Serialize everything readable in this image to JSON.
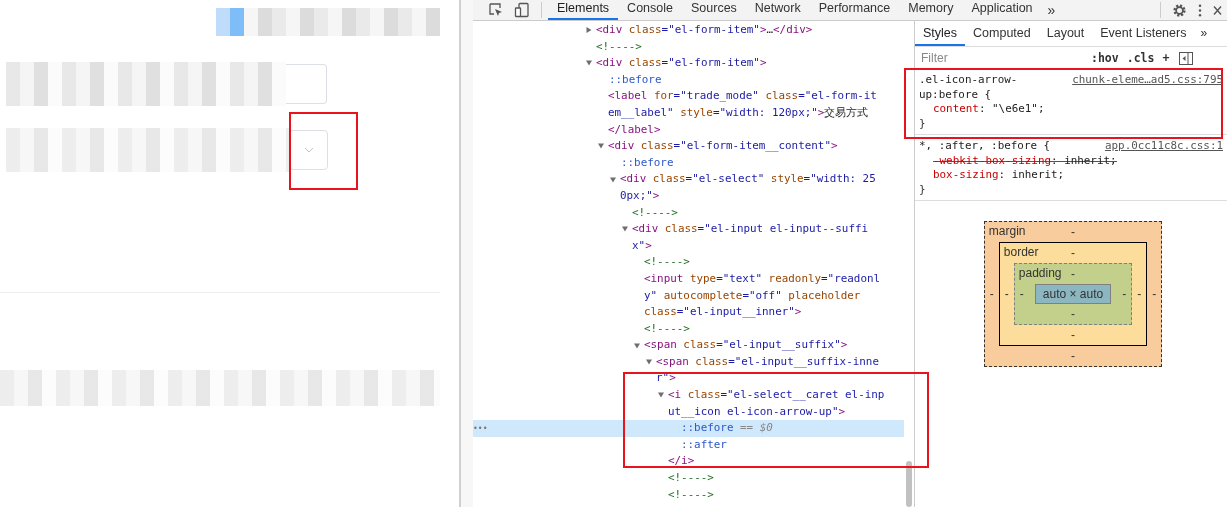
{
  "devtools_tabs": [
    {
      "label": "Elements",
      "selected": true
    },
    {
      "label": "Console",
      "selected": false
    },
    {
      "label": "Sources",
      "selected": false
    },
    {
      "label": "Network",
      "selected": false
    },
    {
      "label": "Performance",
      "selected": false
    },
    {
      "label": "Memory",
      "selected": false
    },
    {
      "label": "Application",
      "selected": false
    }
  ],
  "devtools_tabs_more": "»",
  "elements_panel": {
    "selection_marker": "•••",
    "tree": [
      {
        "kind": "element",
        "expanded": false,
        "selected": false,
        "lines": [
          [
            {
              "kind": "tag",
              "text": "<div"
            },
            {
              "kind": "attr",
              "text": " class"
            },
            {
              "kind": "val",
              "text": "=\"el-form-item\""
            },
            {
              "kind": "tag",
              "text": ">"
            },
            {
              "kind": "text",
              "text": "…"
            },
            {
              "kind": "tag",
              "text": "</div>"
            }
          ]
        ]
      },
      {
        "kind": "comment",
        "selected": false,
        "lines": [
          [
            {
              "kind": "comment",
              "text": "<!---->"
            }
          ]
        ]
      },
      {
        "kind": "element",
        "expanded": true,
        "selected": false,
        "lines": [
          [
            {
              "kind": "tag",
              "text": "<div"
            },
            {
              "kind": "attr",
              "text": " class"
            },
            {
              "kind": "val",
              "text": "=\"el-form-item\""
            },
            {
              "kind": "tag",
              "text": ">"
            }
          ]
        ],
        "children": [
          {
            "kind": "pseudo",
            "selected": false,
            "lines": [
              [
                {
                  "kind": "pseudo",
                  "text": "::before"
                }
              ]
            ]
          },
          {
            "kind": "inline",
            "selected": false,
            "lines": [
              [
                {
                  "kind": "tag",
                  "text": "<label"
                },
                {
                  "kind": "attr",
                  "text": " for"
                },
                {
                  "kind": "val",
                  "text": "=\"trade_mode\""
                },
                {
                  "kind": "attr",
                  "text": " class"
                },
                {
                  "kind": "val",
                  "text": "=\"el-form-it"
                }
              ],
              [
                {
                  "kind": "val",
                  "text": "em__label\""
                },
                {
                  "kind": "attr",
                  "text": " style"
                },
                {
                  "kind": "val",
                  "text": "=\"width: 120px;\""
                },
                {
                  "kind": "tag",
                  "text": ">"
                },
                {
                  "kind": "text",
                  "text": "交易方式"
                }
              ],
              [
                {
                  "kind": "tag",
                  "text": "</label>"
                }
              ]
            ]
          },
          {
            "kind": "element",
            "expanded": true,
            "selected": false,
            "lines": [
              [
                {
                  "kind": "tag",
                  "text": "<div"
                },
                {
                  "kind": "attr",
                  "text": " class"
                },
                {
                  "kind": "val",
                  "text": "=\"el-form-item__content\""
                },
                {
                  "kind": "tag",
                  "text": ">"
                }
              ]
            ],
            "children": [
              {
                "kind": "pseudo",
                "selected": false,
                "lines": [
                  [
                    {
                      "kind": "pseudo",
                      "text": "::before"
                    }
                  ]
                ]
              },
              {
                "kind": "element",
                "expanded": true,
                "selected": false,
                "lines": [
                  [
                    {
                      "kind": "tag",
                      "text": "<div"
                    },
                    {
                      "kind": "attr",
                      "text": " class"
                    },
                    {
                      "kind": "val",
                      "text": "=\"el-select\""
                    },
                    {
                      "kind": "attr",
                      "text": " style"
                    },
                    {
                      "kind": "val",
                      "text": "=\"width: 25"
                    }
                  ],
                  [
                    {
                      "kind": "val",
                      "text": "0px;\""
                    },
                    {
                      "kind": "tag",
                      "text": ">"
                    }
                  ]
                ],
                "children": [
                  {
                    "kind": "comment",
                    "selected": false,
                    "lines": [
                      [
                        {
                          "kind": "comment",
                          "text": "<!---->"
                        }
                      ]
                    ]
                  },
                  {
                    "kind": "element",
                    "expanded": true,
                    "selected": false,
                    "lines": [
                      [
                        {
                          "kind": "tag",
                          "text": "<div"
                        },
                        {
                          "kind": "attr",
                          "text": " class"
                        },
                        {
                          "kind": "val",
                          "text": "=\"el-input el-input--suffi"
                        }
                      ],
                      [
                        {
                          "kind": "val",
                          "text": "x\""
                        },
                        {
                          "kind": "tag",
                          "text": ">"
                        }
                      ]
                    ],
                    "children": [
                      {
                        "kind": "comment",
                        "selected": false,
                        "lines": [
                          [
                            {
                              "kind": "comment",
                              "text": "<!---->"
                            }
                          ]
                        ]
                      },
                      {
                        "kind": "inline",
                        "selected": false,
                        "lines": [
                          [
                            {
                              "kind": "tag",
                              "text": "<input"
                            },
                            {
                              "kind": "attr",
                              "text": " type"
                            },
                            {
                              "kind": "val",
                              "text": "=\"text\""
                            },
                            {
                              "kind": "attr",
                              "text": " readonly"
                            },
                            {
                              "kind": "val",
                              "text": "=\"readonl"
                            }
                          ],
                          [
                            {
                              "kind": "val",
                              "text": "y\""
                            },
                            {
                              "kind": "attr",
                              "text": " autocomplete"
                            },
                            {
                              "kind": "val",
                              "text": "=\"off\""
                            },
                            {
                              "kind": "attr",
                              "text": " placeholder"
                            }
                          ],
                          [
                            {
                              "kind": "attr",
                              "text": "class"
                            },
                            {
                              "kind": "val",
                              "text": "=\"el-input__inner\""
                            },
                            {
                              "kind": "tag",
                              "text": ">"
                            }
                          ]
                        ]
                      },
                      {
                        "kind": "comment",
                        "selected": false,
                        "lines": [
                          [
                            {
                              "kind": "comment",
                              "text": "<!---->"
                            }
                          ]
                        ]
                      },
                      {
                        "kind": "element",
                        "expanded": true,
                        "selected": false,
                        "lines": [
                          [
                            {
                              "kind": "tag",
                              "text": "<span"
                            },
                            {
                              "kind": "attr",
                              "text": " class"
                            },
                            {
                              "kind": "val",
                              "text": "=\"el-input__suffix\""
                            },
                            {
                              "kind": "tag",
                              "text": ">"
                            }
                          ]
                        ],
                        "children": [
                          {
                            "kind": "element",
                            "expanded": true,
                            "selected": false,
                            "lines": [
                              [
                                {
                                  "kind": "tag",
                                  "text": "<span"
                                },
                                {
                                  "kind": "attr",
                                  "text": " class"
                                },
                                {
                                  "kind": "val",
                                  "text": "=\"el-input__suffix-inne"
                                }
                              ],
                              [
                                {
                                  "kind": "val",
                                  "text": "r\""
                                },
                                {
                                  "kind": "tag",
                                  "text": ">"
                                }
                              ]
                            ],
                            "children": [
                              {
                                "kind": "element",
                                "expanded": true,
                                "selected": false,
                                "lines": [
                                  [
                                    {
                                      "kind": "tag",
                                      "text": "<i"
                                    },
                                    {
                                      "kind": "attr",
                                      "text": " class"
                                    },
                                    {
                                      "kind": "val",
                                      "text": "=\"el-select__caret el-inp"
                                    }
                                  ],
                                  [
                                    {
                                      "kind": "val",
                                      "text": "ut__icon el-icon-arrow-up\""
                                    },
                                    {
                                      "kind": "tag",
                                      "text": ">"
                                    }
                                  ]
                                ],
                                "closing": [
                                  {
                                    "kind": "tag",
                                    "text": "</i>"
                                  }
                                ],
                                "children": [
                                  {
                                    "kind": "pseudo",
                                    "selected": true,
                                    "lines": [
                                      [
                                        {
                                          "kind": "pseudo",
                                          "text": "::before"
                                        },
                                        {
                                          "kind": "note",
                                          "text": " == $0"
                                        }
                                      ]
                                    ]
                                  },
                                  {
                                    "kind": "pseudo",
                                    "selected": false,
                                    "lines": [
                                      [
                                        {
                                          "kind": "pseudo",
                                          "text": "::after"
                                        }
                                      ]
                                    ]
                                  }
                                ]
                              },
                              {
                                "kind": "comment",
                                "selected": false,
                                "lines": [
                                  [
                                    {
                                      "kind": "comment",
                                      "text": "<!---->"
                                    }
                                  ]
                                ]
                              },
                              {
                                "kind": "comment",
                                "selected": false,
                                "lines": [
                                  [
                                    {
                                      "kind": "comment",
                                      "text": "<!---->"
                                    }
                                  ]
                                ]
                              }
                            ]
                          }
                        ]
                      }
                    ]
                  }
                ]
              }
            ]
          }
        ]
      }
    ]
  },
  "styles_tabs": [
    {
      "label": "Styles",
      "selected": true
    },
    {
      "label": "Computed",
      "selected": false
    },
    {
      "label": "Layout",
      "selected": false
    },
    {
      "label": "Event Listeners",
      "selected": false
    }
  ],
  "styles_tabs_more": "»",
  "filter": {
    "placeholder": "Filter",
    "buttons": [
      ":hov",
      ".cls",
      "+"
    ]
  },
  "rules": [
    {
      "selector": ".el-icon-arrow-up:before {",
      "source": "chunk-eleme…ad5.css:795",
      "declarations": [
        {
          "property": "content",
          "value": ": \"\\e6e1\";",
          "struck": false
        }
      ],
      "close": "}"
    },
    {
      "selector": "*, :after, :before {",
      "source": "app.0cc11c8c.css:1",
      "declarations": [
        {
          "property": "-webkit-box-sizing",
          "value": ": inherit;",
          "struck": true
        },
        {
          "property": "box-sizing",
          "value": ": inherit;",
          "struck": false
        }
      ],
      "close": "}"
    }
  ],
  "box_model": {
    "margin": {
      "label": "margin",
      "top": "-",
      "right": "-",
      "bottom": "-",
      "left": "-"
    },
    "border": {
      "label": "border",
      "top": "-",
      "right": "-",
      "bottom": "-",
      "left": "-"
    },
    "padding": {
      "label": "padding",
      "top": "-",
      "right": "-",
      "bottom": "-",
      "left": "-"
    },
    "content": "auto × auto"
  }
}
